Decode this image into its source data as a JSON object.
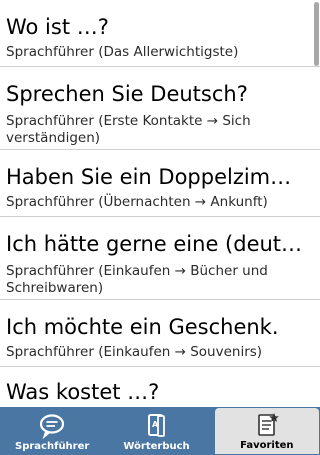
{
  "list": {
    "items": [
      {
        "title": "Wo ist …?",
        "subtitle": "Sprachführer (Das Allerwichtigste)"
      },
      {
        "title": "Sprechen Sie Deutsch?",
        "subtitle": "Sprachführer (Erste Kontakte → Sich verständigen)"
      },
      {
        "title": "Haben Sie ein Doppelzim…",
        "subtitle": "Sprachführer (Übernachten → Ankunft)"
      },
      {
        "title": "Ich hätte gerne eine (deut…",
        "subtitle": "Sprachführer (Einkaufen → Bücher und Schreibwaren)"
      },
      {
        "title": "Ich möchte ein Geschenk.",
        "subtitle": "Sprachführer (Einkaufen → Souvenirs)"
      },
      {
        "title": "Was kostet …?",
        "subtitle": ""
      }
    ]
  },
  "tabs": [
    {
      "label": "Sprachführer",
      "icon": "speech-bubble-icon",
      "active": false
    },
    {
      "label": "Wörterbuch",
      "icon": "dictionary-icon",
      "active": false
    },
    {
      "label": "Favoriten",
      "icon": "favorites-icon",
      "active": true
    }
  ],
  "colors": {
    "tabbar": "#4a76a3",
    "active_tab": "#e2e2e2",
    "divider": "#cfcfcf"
  }
}
